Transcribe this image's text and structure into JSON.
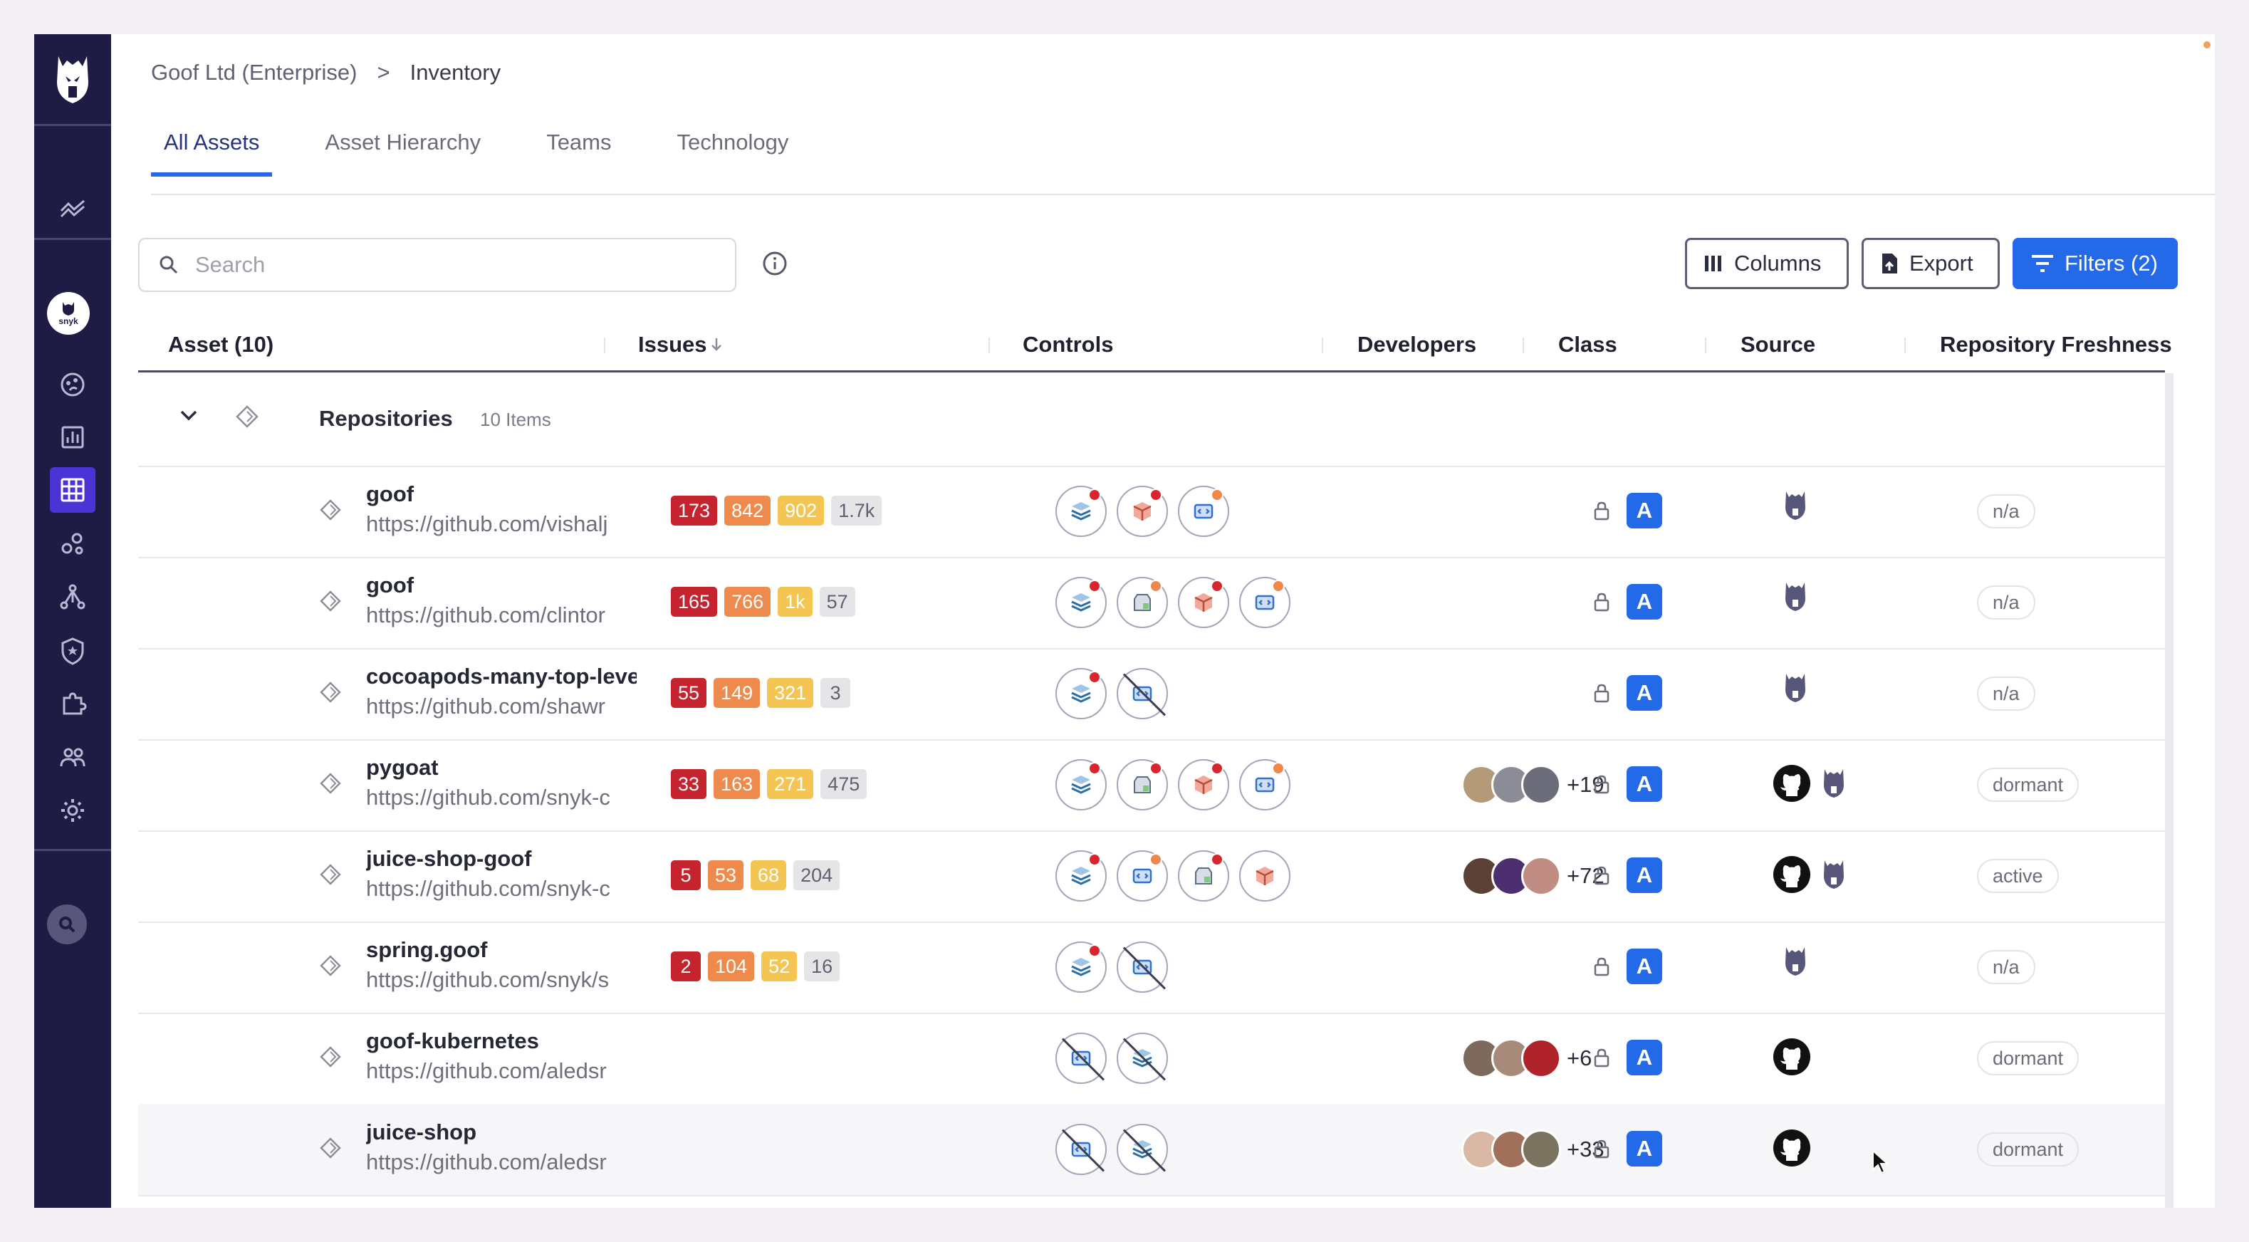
{
  "breadcrumb": {
    "org": "Goof Ltd (Enterprise)",
    "separator": ">",
    "current": "Inventory"
  },
  "tabs": [
    "All Assets",
    "Asset Hierarchy",
    "Teams",
    "Technology"
  ],
  "active_tab": "All Assets",
  "search": {
    "placeholder": "Search"
  },
  "toolbar": {
    "columns_label": "Columns",
    "export_label": "Export",
    "filters_label": "Filters (2)"
  },
  "columns": {
    "asset": "Asset (10)",
    "issues": "Issues",
    "controls": "Controls",
    "developers": "Developers",
    "class": "Class",
    "source": "Source",
    "freshness": "Repository Freshness"
  },
  "sidebar": {
    "org_label": "snyk"
  },
  "group": {
    "title": "Repositories",
    "count": "10 Items"
  },
  "colors": {
    "sidebar_bg": "#1e1b44",
    "accent_blue": "#2469e8",
    "critical": "#c5242f",
    "high": "#ee8a4c",
    "medium": "#f4c552",
    "low": "#e5e5e8"
  },
  "rows": [
    {
      "name": "goof",
      "url": "https://github.com/vishalj",
      "issues": [
        "173",
        "842",
        "902",
        "1.7k"
      ],
      "controls": [
        {
          "icon": "code-icon",
          "dot": "red"
        },
        {
          "icon": "container-icon",
          "dot": "red"
        },
        {
          "icon": "sast-icon",
          "dot": "orange"
        }
      ],
      "developers": [],
      "dev_more": "",
      "class": "A",
      "sources": [
        "snyk"
      ],
      "freshness": "n/a"
    },
    {
      "name": "goof",
      "url": "https://github.com/clintor",
      "issues": [
        "165",
        "766",
        "1k",
        "57"
      ],
      "controls": [
        {
          "icon": "code-icon",
          "dot": "red"
        },
        {
          "icon": "iac-icon",
          "dot": "orange"
        },
        {
          "icon": "container-icon",
          "dot": "red"
        },
        {
          "icon": "sast-icon",
          "dot": "orange"
        }
      ],
      "developers": [],
      "dev_more": "",
      "class": "A",
      "sources": [
        "snyk"
      ],
      "freshness": "n/a"
    },
    {
      "name": "cocoapods-many-top-leve",
      "url": "https://github.com/shawr",
      "issues": [
        "55",
        "149",
        "321",
        "3"
      ],
      "controls": [
        {
          "icon": "code-icon",
          "dot": "red"
        },
        {
          "icon": "sast-icon",
          "dot": "",
          "off": true
        }
      ],
      "developers": [],
      "dev_more": "",
      "class": "A",
      "sources": [
        "snyk"
      ],
      "freshness": "n/a"
    },
    {
      "name": "pygoat",
      "url": "https://github.com/snyk-c",
      "issues": [
        "33",
        "163",
        "271",
        "475"
      ],
      "controls": [
        {
          "icon": "code-icon",
          "dot": "red"
        },
        {
          "icon": "iac-icon",
          "dot": "red"
        },
        {
          "icon": "container-icon",
          "dot": "red"
        },
        {
          "icon": "sast-icon",
          "dot": "orange"
        }
      ],
      "developers": [
        "#b59a7a",
        "#8c8c96",
        "#6b6e7a"
      ],
      "dev_more": "+19",
      "class": "A",
      "sources": [
        "github",
        "snyk"
      ],
      "freshness": "dormant"
    },
    {
      "name": "juice-shop-goof",
      "url": "https://github.com/snyk-c",
      "issues": [
        "5",
        "53",
        "68",
        "204"
      ],
      "controls": [
        {
          "icon": "code-icon",
          "dot": "red"
        },
        {
          "icon": "sast-icon",
          "dot": "orange"
        },
        {
          "icon": "iac-icon",
          "dot": "red"
        },
        {
          "icon": "container-icon",
          "dot": ""
        }
      ],
      "developers": [
        "#5a4035",
        "#4b2f6e",
        "#c08c84"
      ],
      "dev_more": "+72",
      "class": "A",
      "sources": [
        "github",
        "snyk"
      ],
      "freshness": "active"
    },
    {
      "name": "spring.goof",
      "url": "https://github.com/snyk/s",
      "issues": [
        "2",
        "104",
        "52",
        "16"
      ],
      "controls": [
        {
          "icon": "code-icon",
          "dot": "red"
        },
        {
          "icon": "sast-icon",
          "dot": "",
          "off": true
        }
      ],
      "developers": [],
      "dev_more": "",
      "class": "A",
      "sources": [
        "snyk"
      ],
      "freshness": "n/a"
    },
    {
      "name": "goof-kubernetes",
      "url": "https://github.com/aledsr",
      "issues": [],
      "controls": [
        {
          "icon": "sast-icon",
          "dot": "",
          "off": true
        },
        {
          "icon": "code-icon",
          "dot": "",
          "off": true
        }
      ],
      "developers": [
        "#7d6a5c",
        "#a88a7a",
        "#b0232a"
      ],
      "dev_more": "+6",
      "class": "A",
      "sources": [
        "github"
      ],
      "freshness": "dormant"
    },
    {
      "name": "juice-shop",
      "url": "https://github.com/aledsr",
      "issues": [],
      "controls": [
        {
          "icon": "sast-icon",
          "dot": "",
          "off": true
        },
        {
          "icon": "code-icon",
          "dot": "",
          "off": true
        }
      ],
      "developers": [
        "#d9b8a6",
        "#a0705a",
        "#7c7260"
      ],
      "dev_more": "+33",
      "class": "A",
      "sources": [
        "github"
      ],
      "freshness": "dormant"
    }
  ]
}
